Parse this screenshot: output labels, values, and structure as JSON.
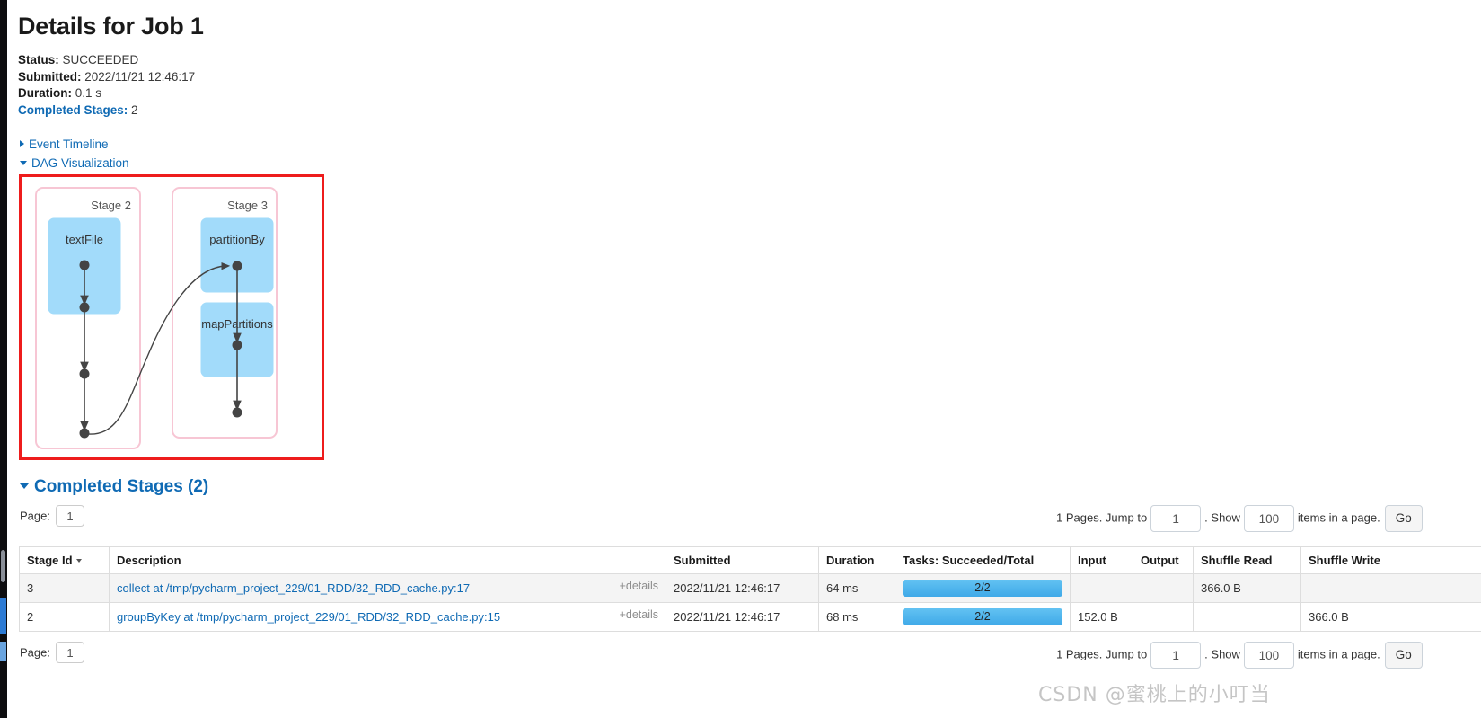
{
  "header": {
    "title": "Details for Job 1"
  },
  "meta": {
    "status_label": "Status:",
    "status_value": "SUCCEEDED",
    "submitted_label": "Submitted:",
    "submitted_value": "2022/11/21 12:46:17",
    "duration_label": "Duration:",
    "duration_value": "0.1 s",
    "completed_stages_label": "Completed Stages:",
    "completed_stages_value": "2"
  },
  "toggles": {
    "event_timeline": "Event Timeline",
    "dag_visualization": "DAG Visualization"
  },
  "dag": {
    "highlight_color": "#ee1c1c",
    "stage_border_color": "#f7c6d4",
    "rdd_fill_color": "#a2dbfa",
    "node_color": "#444444",
    "stages": [
      {
        "label": "Stage 2",
        "rdds": [
          "textFile"
        ]
      },
      {
        "label": "Stage 3",
        "rdds": [
          "partitionBy",
          "mapPartitions"
        ]
      }
    ]
  },
  "stages_section": {
    "heading": "Completed Stages (2)",
    "page_label": "Page:",
    "page_value": "1",
    "pager": {
      "pages_text": "1 Pages. Jump to",
      "jump_value": "1",
      "show_text": ". Show",
      "show_value": "100",
      "items_text": "items in a page.",
      "go_label": "Go"
    },
    "columns": [
      "Stage Id",
      "Description",
      "Submitted",
      "Duration",
      "Tasks: Succeeded/Total",
      "Input",
      "Output",
      "Shuffle Read",
      "Shuffle Write"
    ],
    "sorted_column": "Stage Id",
    "rows": [
      {
        "stage_id": "3",
        "description": "collect at /tmp/pycharm_project_229/01_RDD/32_RDD_cache.py:17",
        "details_label": "+details",
        "submitted": "2022/11/21 12:46:17",
        "duration": "64 ms",
        "tasks": "2/2",
        "tasks_pct": 100,
        "input": "",
        "output": "",
        "shuffle_read": "366.0 B",
        "shuffle_write": ""
      },
      {
        "stage_id": "2",
        "description": "groupByKey at /tmp/pycharm_project_229/01_RDD/32_RDD_cache.py:15",
        "details_label": "+details",
        "submitted": "2022/11/21 12:46:17",
        "duration": "68 ms",
        "tasks": "2/2",
        "tasks_pct": 100,
        "input": "152.0 B",
        "output": "",
        "shuffle_read": "",
        "shuffle_write": "366.0 B"
      }
    ]
  },
  "footer": {
    "page_label": "Page:",
    "page_value": "1",
    "pager": {
      "pages_text": "1 Pages. Jump to",
      "jump_value": "1",
      "show_text": ". Show",
      "show_value": "100",
      "items_text": "items in a page.",
      "go_label": "Go"
    }
  },
  "watermark": {
    "text": "CSDN @蜜桃上的小叮当"
  }
}
